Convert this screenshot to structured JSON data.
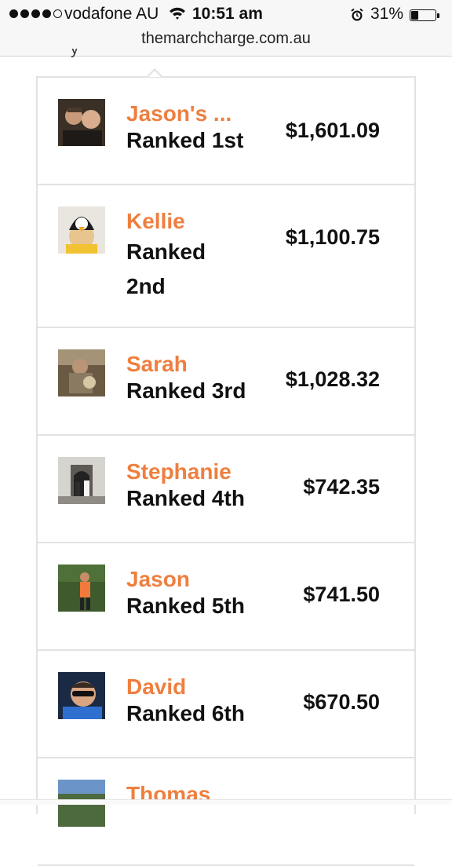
{
  "status_bar": {
    "carrier": "vodafone AU",
    "time": "10:51 am",
    "battery_percent": "31%",
    "battery_level": 0.31,
    "signal_bars_filled": 4,
    "signal_bars_total": 5
  },
  "browser": {
    "url": "themarchcharge.com.au"
  },
  "colors": {
    "name_accent": "#ee7f3f",
    "text": "#111111",
    "divider": "#e2e2e2"
  },
  "leaderboard": [
    {
      "name": "Jason's ...",
      "rank": "Ranked 1st",
      "amount": "$1,601.09"
    },
    {
      "name": "Kellie",
      "rank": "Ranked 2nd",
      "amount": "$1,100.75"
    },
    {
      "name": "Sarah",
      "rank": "Ranked 3rd",
      "amount": "$1,028.32"
    },
    {
      "name": "Stephanie",
      "rank": "Ranked 4th",
      "amount": "$742.35"
    },
    {
      "name": "Jason",
      "rank": "Ranked 5th",
      "amount": "$741.50"
    },
    {
      "name": "David",
      "rank": "Ranked 6th",
      "amount": "$670.50"
    },
    {
      "name": "Thomas",
      "rank": "",
      "amount": ""
    }
  ]
}
